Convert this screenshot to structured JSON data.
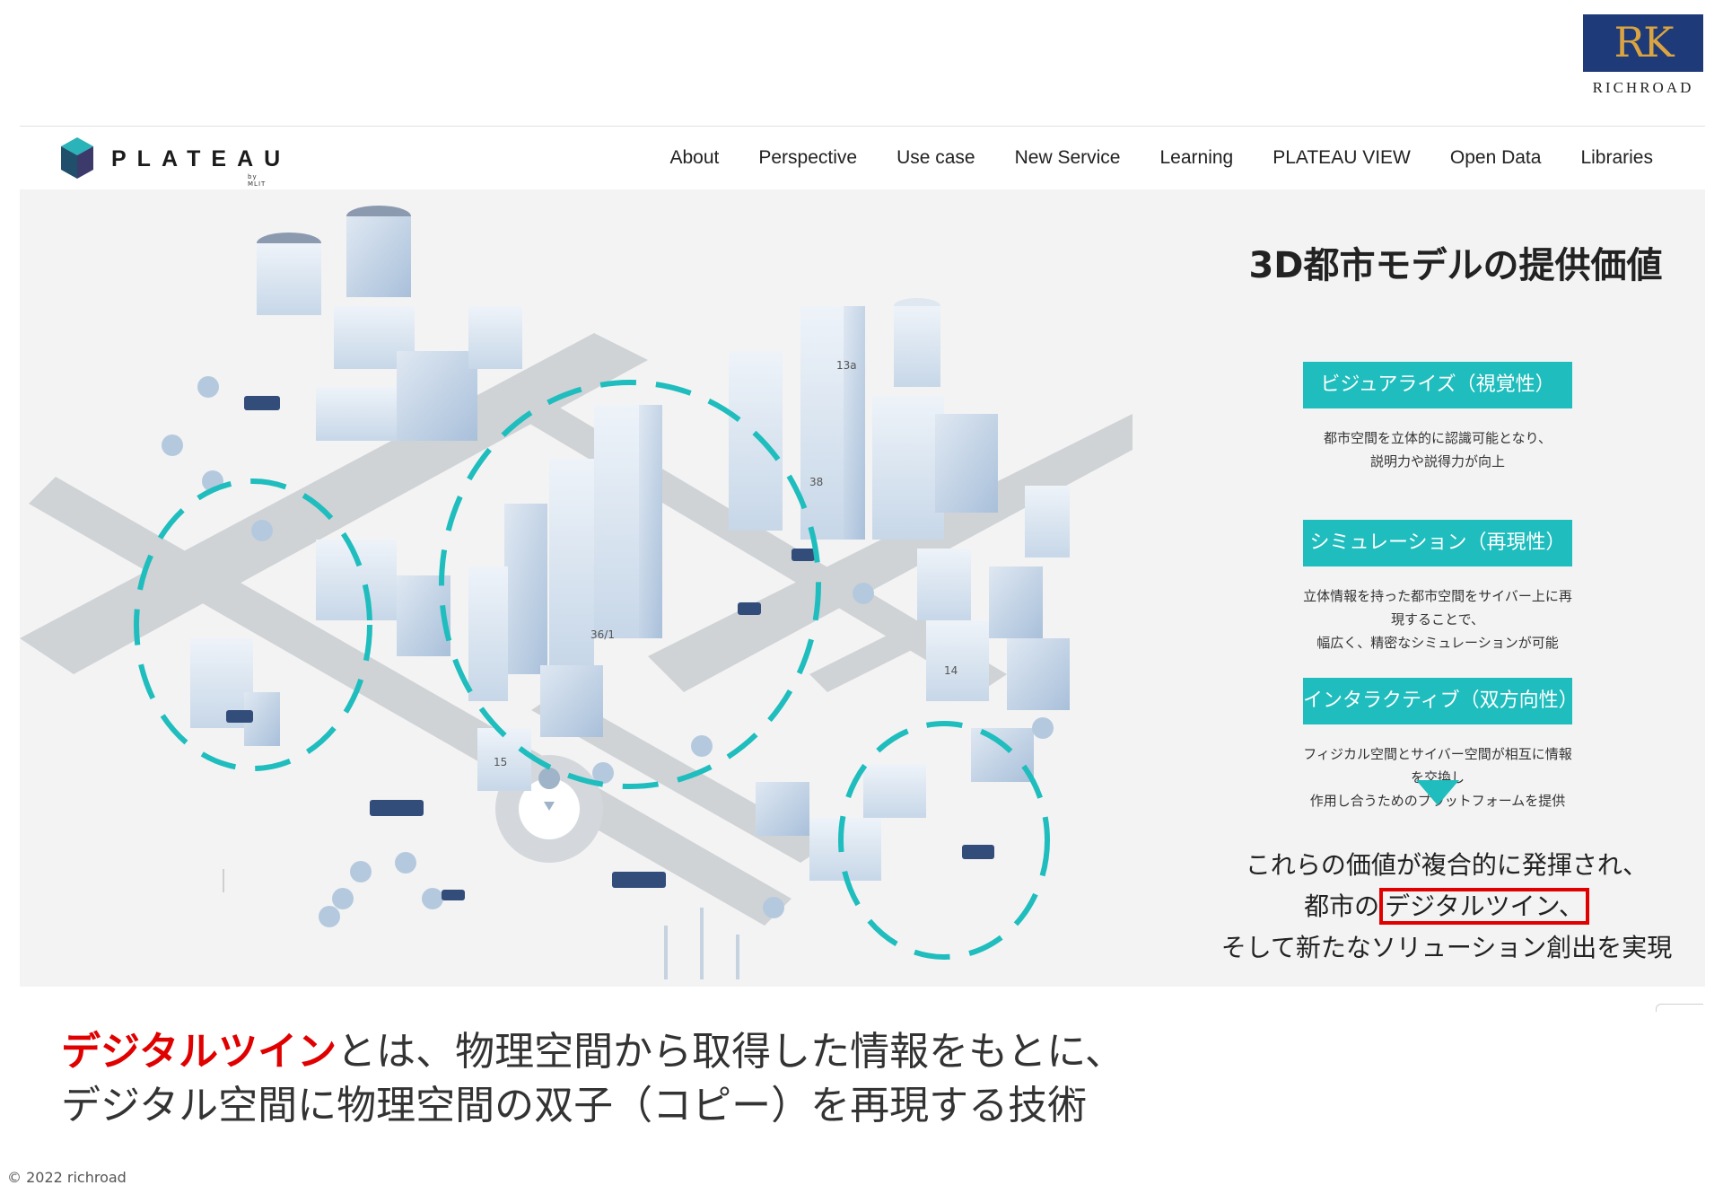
{
  "brand": {
    "name": "RICHROAD",
    "monogram": "RK",
    "box_color": "#1e3a78",
    "mono_color": "#d9a441"
  },
  "site": {
    "logo_word": "PLATEAU",
    "logo_sub": "by MLIT",
    "nav": [
      "About",
      "Perspective",
      "Use case",
      "New Service",
      "Learning",
      "PLATEAU VIEW",
      "Open Data",
      "Libraries"
    ]
  },
  "illustration": {
    "building_labels": [
      "13a",
      "38",
      "36/1",
      "14",
      "15"
    ],
    "accent_color": "#1fbdbd"
  },
  "panel": {
    "title": "3D都市モデルの提供価値",
    "values": [
      {
        "label": "ビジュアライズ（視覚性）",
        "desc_line1": "都市空間を立体的に認識可能となり、",
        "desc_line2": "説明力や説得力が向上"
      },
      {
        "label": "シミュレーション（再現性）",
        "desc_line1": "立体情報を持った都市空間をサイバー上に再現することで、",
        "desc_line2": "幅広く、精密なシミュレーションが可能"
      },
      {
        "label": "インタラクティブ（双方向性）",
        "desc_line1": "フィジカル空間とサイバー空間が相互に情報を交換し",
        "desc_line2": "作用し合うためのプラットフォームを提供"
      }
    ],
    "conclusion_line1": "これらの価値が複合的に発揮され、",
    "conclusion_line2_pre": "都市の",
    "conclusion_line2_hl": "デジタルツイン、",
    "conclusion_line3": "そして新たなソリューション創出を実現",
    "highlight_color": "#e00000"
  },
  "caption": {
    "term": "デジタルツイン",
    "line1_rest": "とは、物理空間から取得した情報をもとに、",
    "line2": "デジタル空間に物理空間の双子（コピー）を再現する技術"
  },
  "footer": {
    "copyright": "© 2022 richroad"
  }
}
